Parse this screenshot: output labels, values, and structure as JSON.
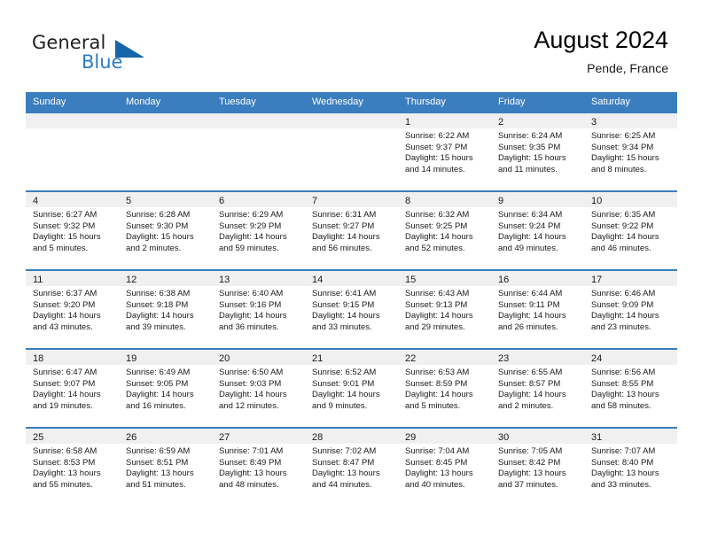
{
  "brand": {
    "name_part1": "General",
    "name_part2": "Blue",
    "logo_icon": "blue-triangle-icon"
  },
  "header": {
    "title": "August 2024",
    "location": "Pende, France"
  },
  "calendar": {
    "weekday_headers": [
      "Sunday",
      "Monday",
      "Tuesday",
      "Wednesday",
      "Thursday",
      "Friday",
      "Saturday"
    ],
    "accent_color": "#3a7ebf",
    "daynum_bar_color": "#f0f0f0",
    "weeks": [
      [
        {
          "day": "",
          "sunrise": "",
          "sunset": "",
          "daylight_line1": "",
          "daylight_line2": ""
        },
        {
          "day": "",
          "sunrise": "",
          "sunset": "",
          "daylight_line1": "",
          "daylight_line2": ""
        },
        {
          "day": "",
          "sunrise": "",
          "sunset": "",
          "daylight_line1": "",
          "daylight_line2": ""
        },
        {
          "day": "",
          "sunrise": "",
          "sunset": "",
          "daylight_line1": "",
          "daylight_line2": ""
        },
        {
          "day": "1",
          "sunrise": "Sunrise: 6:22 AM",
          "sunset": "Sunset: 9:37 PM",
          "daylight_line1": "Daylight: 15 hours",
          "daylight_line2": "and 14 minutes."
        },
        {
          "day": "2",
          "sunrise": "Sunrise: 6:24 AM",
          "sunset": "Sunset: 9:35 PM",
          "daylight_line1": "Daylight: 15 hours",
          "daylight_line2": "and 11 minutes."
        },
        {
          "day": "3",
          "sunrise": "Sunrise: 6:25 AM",
          "sunset": "Sunset: 9:34 PM",
          "daylight_line1": "Daylight: 15 hours",
          "daylight_line2": "and 8 minutes."
        }
      ],
      [
        {
          "day": "4",
          "sunrise": "Sunrise: 6:27 AM",
          "sunset": "Sunset: 9:32 PM",
          "daylight_line1": "Daylight: 15 hours",
          "daylight_line2": "and 5 minutes."
        },
        {
          "day": "5",
          "sunrise": "Sunrise: 6:28 AM",
          "sunset": "Sunset: 9:30 PM",
          "daylight_line1": "Daylight: 15 hours",
          "daylight_line2": "and 2 minutes."
        },
        {
          "day": "6",
          "sunrise": "Sunrise: 6:29 AM",
          "sunset": "Sunset: 9:29 PM",
          "daylight_line1": "Daylight: 14 hours",
          "daylight_line2": "and 59 minutes."
        },
        {
          "day": "7",
          "sunrise": "Sunrise: 6:31 AM",
          "sunset": "Sunset: 9:27 PM",
          "daylight_line1": "Daylight: 14 hours",
          "daylight_line2": "and 56 minutes."
        },
        {
          "day": "8",
          "sunrise": "Sunrise: 6:32 AM",
          "sunset": "Sunset: 9:25 PM",
          "daylight_line1": "Daylight: 14 hours",
          "daylight_line2": "and 52 minutes."
        },
        {
          "day": "9",
          "sunrise": "Sunrise: 6:34 AM",
          "sunset": "Sunset: 9:24 PM",
          "daylight_line1": "Daylight: 14 hours",
          "daylight_line2": "and 49 minutes."
        },
        {
          "day": "10",
          "sunrise": "Sunrise: 6:35 AM",
          "sunset": "Sunset: 9:22 PM",
          "daylight_line1": "Daylight: 14 hours",
          "daylight_line2": "and 46 minutes."
        }
      ],
      [
        {
          "day": "11",
          "sunrise": "Sunrise: 6:37 AM",
          "sunset": "Sunset: 9:20 PM",
          "daylight_line1": "Daylight: 14 hours",
          "daylight_line2": "and 43 minutes."
        },
        {
          "day": "12",
          "sunrise": "Sunrise: 6:38 AM",
          "sunset": "Sunset: 9:18 PM",
          "daylight_line1": "Daylight: 14 hours",
          "daylight_line2": "and 39 minutes."
        },
        {
          "day": "13",
          "sunrise": "Sunrise: 6:40 AM",
          "sunset": "Sunset: 9:16 PM",
          "daylight_line1": "Daylight: 14 hours",
          "daylight_line2": "and 36 minutes."
        },
        {
          "day": "14",
          "sunrise": "Sunrise: 6:41 AM",
          "sunset": "Sunset: 9:15 PM",
          "daylight_line1": "Daylight: 14 hours",
          "daylight_line2": "and 33 minutes."
        },
        {
          "day": "15",
          "sunrise": "Sunrise: 6:43 AM",
          "sunset": "Sunset: 9:13 PM",
          "daylight_line1": "Daylight: 14 hours",
          "daylight_line2": "and 29 minutes."
        },
        {
          "day": "16",
          "sunrise": "Sunrise: 6:44 AM",
          "sunset": "Sunset: 9:11 PM",
          "daylight_line1": "Daylight: 14 hours",
          "daylight_line2": "and 26 minutes."
        },
        {
          "day": "17",
          "sunrise": "Sunrise: 6:46 AM",
          "sunset": "Sunset: 9:09 PM",
          "daylight_line1": "Daylight: 14 hours",
          "daylight_line2": "and 23 minutes."
        }
      ],
      [
        {
          "day": "18",
          "sunrise": "Sunrise: 6:47 AM",
          "sunset": "Sunset: 9:07 PM",
          "daylight_line1": "Daylight: 14 hours",
          "daylight_line2": "and 19 minutes."
        },
        {
          "day": "19",
          "sunrise": "Sunrise: 6:49 AM",
          "sunset": "Sunset: 9:05 PM",
          "daylight_line1": "Daylight: 14 hours",
          "daylight_line2": "and 16 minutes."
        },
        {
          "day": "20",
          "sunrise": "Sunrise: 6:50 AM",
          "sunset": "Sunset: 9:03 PM",
          "daylight_line1": "Daylight: 14 hours",
          "daylight_line2": "and 12 minutes."
        },
        {
          "day": "21",
          "sunrise": "Sunrise: 6:52 AM",
          "sunset": "Sunset: 9:01 PM",
          "daylight_line1": "Daylight: 14 hours",
          "daylight_line2": "and 9 minutes."
        },
        {
          "day": "22",
          "sunrise": "Sunrise: 6:53 AM",
          "sunset": "Sunset: 8:59 PM",
          "daylight_line1": "Daylight: 14 hours",
          "daylight_line2": "and 5 minutes."
        },
        {
          "day": "23",
          "sunrise": "Sunrise: 6:55 AM",
          "sunset": "Sunset: 8:57 PM",
          "daylight_line1": "Daylight: 14 hours",
          "daylight_line2": "and 2 minutes."
        },
        {
          "day": "24",
          "sunrise": "Sunrise: 6:56 AM",
          "sunset": "Sunset: 8:55 PM",
          "daylight_line1": "Daylight: 13 hours",
          "daylight_line2": "and 58 minutes."
        }
      ],
      [
        {
          "day": "25",
          "sunrise": "Sunrise: 6:58 AM",
          "sunset": "Sunset: 8:53 PM",
          "daylight_line1": "Daylight: 13 hours",
          "daylight_line2": "and 55 minutes."
        },
        {
          "day": "26",
          "sunrise": "Sunrise: 6:59 AM",
          "sunset": "Sunset: 8:51 PM",
          "daylight_line1": "Daylight: 13 hours",
          "daylight_line2": "and 51 minutes."
        },
        {
          "day": "27",
          "sunrise": "Sunrise: 7:01 AM",
          "sunset": "Sunset: 8:49 PM",
          "daylight_line1": "Daylight: 13 hours",
          "daylight_line2": "and 48 minutes."
        },
        {
          "day": "28",
          "sunrise": "Sunrise: 7:02 AM",
          "sunset": "Sunset: 8:47 PM",
          "daylight_line1": "Daylight: 13 hours",
          "daylight_line2": "and 44 minutes."
        },
        {
          "day": "29",
          "sunrise": "Sunrise: 7:04 AM",
          "sunset": "Sunset: 8:45 PM",
          "daylight_line1": "Daylight: 13 hours",
          "daylight_line2": "and 40 minutes."
        },
        {
          "day": "30",
          "sunrise": "Sunrise: 7:05 AM",
          "sunset": "Sunset: 8:42 PM",
          "daylight_line1": "Daylight: 13 hours",
          "daylight_line2": "and 37 minutes."
        },
        {
          "day": "31",
          "sunrise": "Sunrise: 7:07 AM",
          "sunset": "Sunset: 8:40 PM",
          "daylight_line1": "Daylight: 13 hours",
          "daylight_line2": "and 33 minutes."
        }
      ]
    ]
  }
}
